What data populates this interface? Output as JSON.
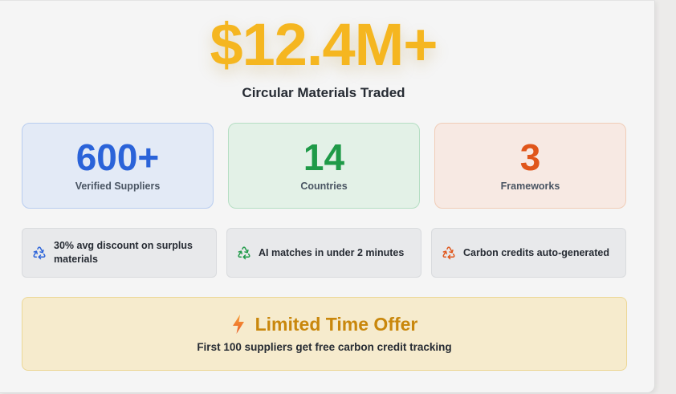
{
  "hero": {
    "value": "$12.4M+",
    "label": "Circular Materials Traded"
  },
  "stats": [
    {
      "value": "600+",
      "label": "Verified Suppliers",
      "color": "#2b63d9"
    },
    {
      "value": "14",
      "label": "Countries",
      "color": "#1f9a48"
    },
    {
      "value": "3",
      "label": "Frameworks",
      "color": "#e0561b"
    }
  ],
  "features": [
    {
      "text": "30% avg discount on surplus materials",
      "icon": "recycle-icon",
      "color": "#2b63d9"
    },
    {
      "text": "AI matches in under 2 minutes",
      "icon": "recycle-icon",
      "color": "#1f9a48"
    },
    {
      "text": "Carbon credits auto-generated",
      "icon": "recycle-icon",
      "color": "#e0561b"
    }
  ],
  "offer": {
    "icon": "lightning-bolt-icon",
    "title": "Limited Time Offer",
    "subtitle": "First 100 suppliers get free carbon credit tracking"
  },
  "colors": {
    "hero_accent": "#f5b620",
    "offer_title": "#c9870c"
  }
}
